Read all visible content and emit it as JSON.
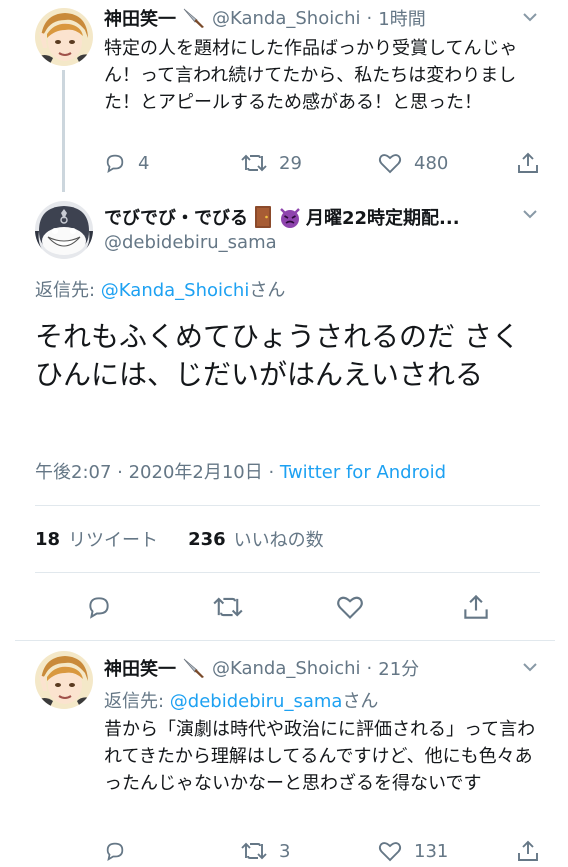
{
  "tweet1": {
    "display_name": "神田笑一",
    "name_icon": "knife-icon",
    "handle": "@Kanda_Shoichi",
    "separator": "·",
    "time": "1時間",
    "text": "特定の人を題材にした作品ばっかり受賞してんじゃん！って言われ続けてたから、私たちは変わりました！とアピールするため感がある！と思った！",
    "replies": "4",
    "retweets": "29",
    "likes": "480"
  },
  "tweet2": {
    "display_name": "でびでび・でびる",
    "name_icons": [
      "door-icon",
      "devil-face-icon"
    ],
    "name_suffix": "月曜22時定期配...",
    "handle": "@debidebiru_sama",
    "reply_to_prefix": "返信先: ",
    "reply_to_handle": "@Kanda_Shoichi",
    "reply_to_suffix": "さん",
    "text": "それもふくめてひょうされるのだ さくひんには、じだいがはんえいされる",
    "timestamp": "午後2:07 · 2020年2月10日 · ",
    "client": "Twitter for Android",
    "retweet_count": "18",
    "retweet_label": "リツイート",
    "like_count": "236",
    "like_label": "いいねの数"
  },
  "tweet3": {
    "display_name": "神田笑一",
    "name_icon": "knife-icon",
    "handle": "@Kanda_Shoichi",
    "separator": "·",
    "time": "21分",
    "reply_to_prefix": "返信先: ",
    "reply_to_handle": "@debidebiru_sama",
    "reply_to_suffix": "さん",
    "text": "昔から「演劇は時代や政治にに評価される」って言われてきたから理解はしてるんですけど、他にも色々あったんじゃないかなーと思わざるを得ないです",
    "replies": "",
    "retweets": "3",
    "likes": "131"
  },
  "colors": {
    "text": "#14171a",
    "muted": "#657786",
    "link": "#1da1f2",
    "divider": "#e1e8ed",
    "thread_line": "#ccd6dd"
  }
}
